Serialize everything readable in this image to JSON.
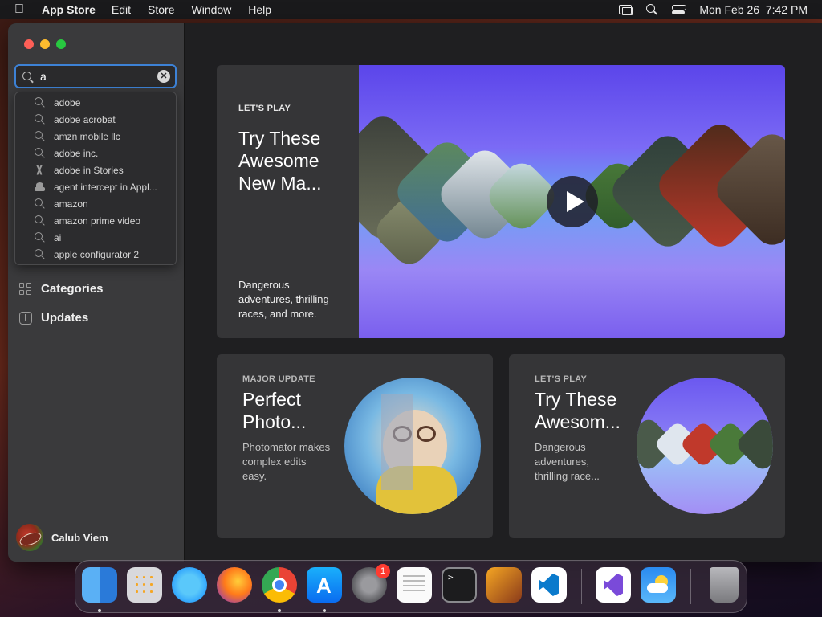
{
  "menubar": {
    "app_name": "App Store",
    "menus": [
      "Edit",
      "Store",
      "Window",
      "Help"
    ],
    "datetime": "Mon Feb 26  7:42 PM"
  },
  "search": {
    "value": "a",
    "suggestions": [
      {
        "icon": "search-icon",
        "text": "adobe"
      },
      {
        "icon": "search-icon",
        "text": "adobe acrobat"
      },
      {
        "icon": "search-icon",
        "text": "amzn mobile llc"
      },
      {
        "icon": "search-icon",
        "text": "adobe inc."
      },
      {
        "icon": "stories-icon",
        "text": "adobe in Stories"
      },
      {
        "icon": "app-icon",
        "text": "agent intercept in Appl..."
      },
      {
        "icon": "search-icon",
        "text": "amazon"
      },
      {
        "icon": "search-icon",
        "text": "amazon prime video"
      },
      {
        "icon": "search-icon",
        "text": "ai"
      },
      {
        "icon": "search-icon",
        "text": "apple configurator 2"
      }
    ]
  },
  "sidebar": {
    "categories_label": "Categories",
    "updates_label": "Updates",
    "user_name": "Calub Viem"
  },
  "hero": {
    "eyebrow": "LET'S PLAY",
    "title": "Try These Awesome New Ma...",
    "description": "Dangerous adventures, thrilling races, and more."
  },
  "cards": [
    {
      "eyebrow": "MAJOR UPDATE",
      "title": "Perfect Photo...",
      "description": "Photomator makes complex edits easy."
    },
    {
      "eyebrow": "LET'S PLAY",
      "title": "Try These Awesom...",
      "description": "Dangerous adventures, thrilling race..."
    }
  ],
  "dock": {
    "apps": [
      "finder-icon",
      "launchpad-icon",
      "safari-icon",
      "firefox-icon",
      "chrome-icon",
      "app-store-icon",
      "system-settings-icon",
      "textedit-icon",
      "terminal-icon",
      "garageband-icon",
      "vscode-icon",
      "visual-studio-icon",
      "weather-icon",
      "trash-icon"
    ],
    "settings_badge": "1"
  },
  "colors": {
    "accent": "#3d82d6",
    "sidebar_bg": "#3a3a3c",
    "main_bg": "#1f1f21",
    "card_bg": "#353537"
  }
}
